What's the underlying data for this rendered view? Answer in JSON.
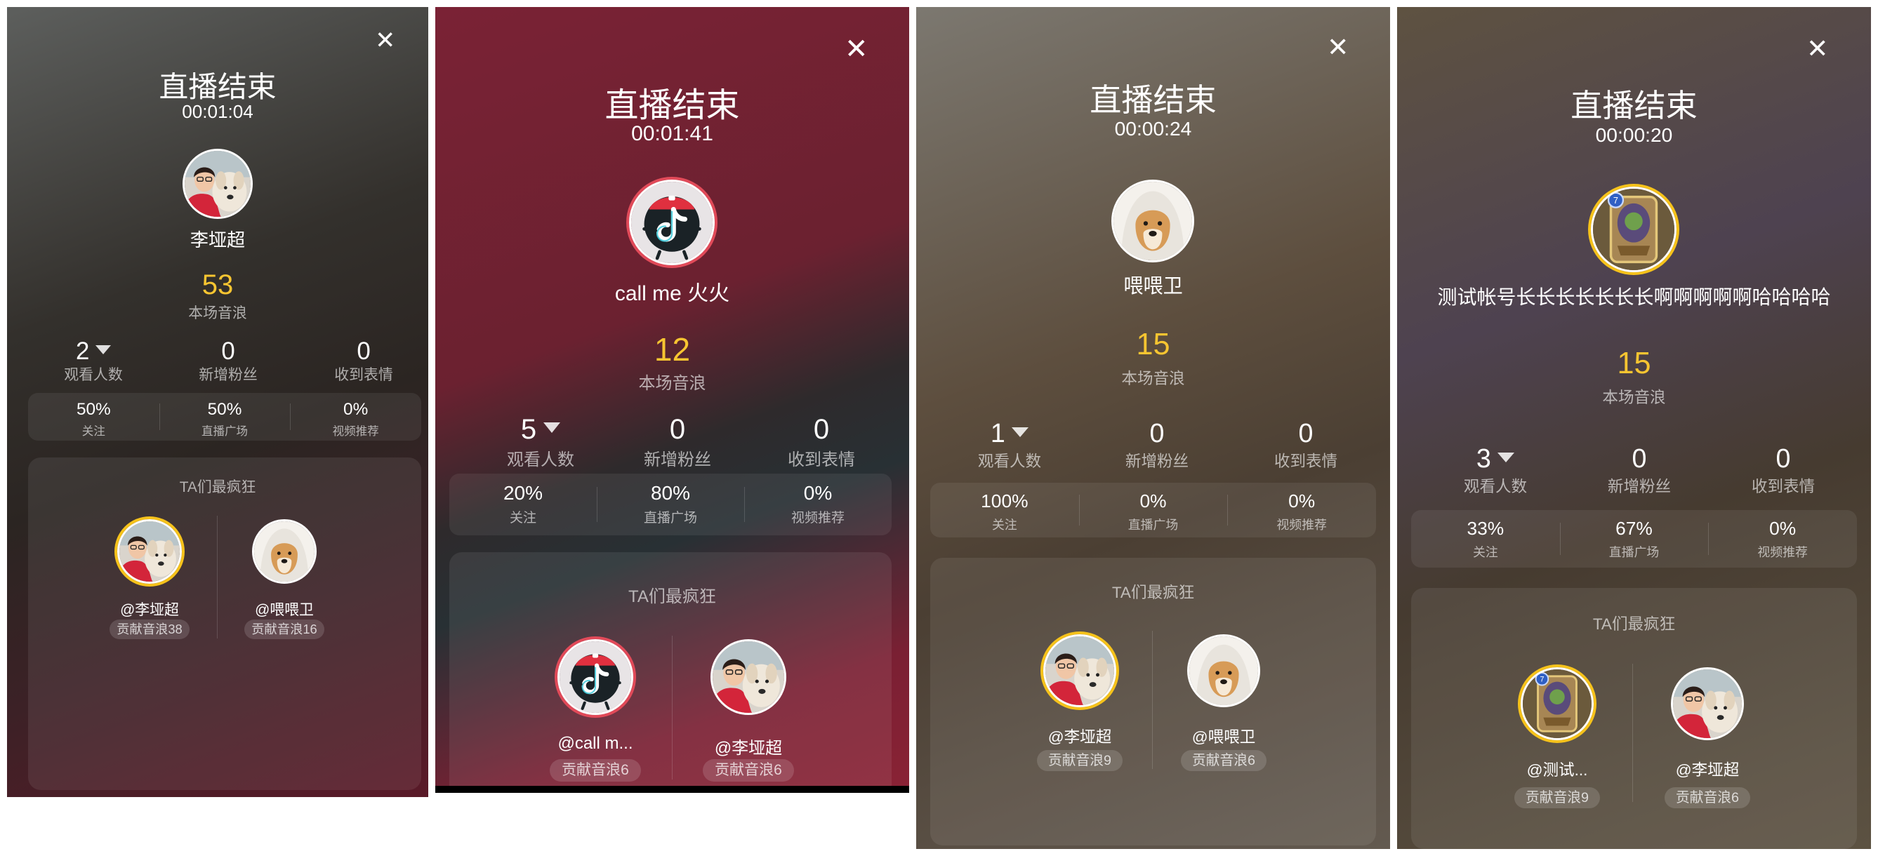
{
  "screens": [
    {
      "close_icon": "close-icon",
      "title": "直播结束",
      "duration": "00:01:04",
      "host": {
        "name": "李垭超",
        "avatar": "person-with-dog"
      },
      "total_yinlang": "53",
      "total_label": "本场音浪",
      "stats": [
        {
          "value": "2",
          "label": "观看人数",
          "has_dropdown": true
        },
        {
          "value": "0",
          "label": "新增粉丝"
        },
        {
          "value": "0",
          "label": "收到表情"
        }
      ],
      "sources": [
        {
          "value": "50%",
          "label": "关注"
        },
        {
          "value": "50%",
          "label": "直播广场"
        },
        {
          "value": "0%",
          "label": "视频推荐"
        }
      ],
      "fans_title": "TA们最疯狂",
      "fans": [
        {
          "name": "@李垭超",
          "contribution": "贡献音浪38",
          "avatar": "person-with-dog"
        },
        {
          "name": "@喂喂卫",
          "contribution": "贡献音浪16",
          "avatar": "shiba-dog"
        }
      ],
      "nav": {
        "style": "light",
        "icons": [
          "back-chevron-icon",
          "square-icon",
          "menu-lines-icon"
        ]
      }
    },
    {
      "close_icon": "close-icon",
      "title": "直播结束",
      "duration": "00:01:41",
      "host": {
        "name": "call me 火火",
        "avatar": "tiktok-logo"
      },
      "total_yinlang": "12",
      "total_label": "本场音浪",
      "stats": [
        {
          "value": "5",
          "label": "观看人数",
          "has_dropdown": true
        },
        {
          "value": "0",
          "label": "新增粉丝"
        },
        {
          "value": "0",
          "label": "收到表情"
        }
      ],
      "sources": [
        {
          "value": "20%",
          "label": "关注"
        },
        {
          "value": "80%",
          "label": "直播广场"
        },
        {
          "value": "0%",
          "label": "视频推荐"
        }
      ],
      "fans_title": "TA们最疯狂",
      "fans": [
        {
          "name": "@call m...",
          "contribution": "贡献音浪6",
          "avatar": "tiktok-logo"
        },
        {
          "name": "@李垭超",
          "contribution": "贡献音浪6",
          "avatar": "person-with-dog"
        }
      ],
      "nav": {
        "style": "dark",
        "icons": [
          "chevron-down-icon",
          "back-triangle-icon",
          "home-circle-icon",
          "recent-square-icon"
        ]
      }
    },
    {
      "close_icon": "close-icon",
      "title": "直播结束",
      "duration": "00:00:24",
      "host": {
        "name": "喂喂卫",
        "avatar": "shiba-dog"
      },
      "total_yinlang": "15",
      "total_label": "本场音浪",
      "stats": [
        {
          "value": "1",
          "label": "观看人数",
          "has_dropdown": true
        },
        {
          "value": "0",
          "label": "新增粉丝"
        },
        {
          "value": "0",
          "label": "收到表情"
        }
      ],
      "sources": [
        {
          "value": "100%",
          "label": "关注"
        },
        {
          "value": "0%",
          "label": "直播广场"
        },
        {
          "value": "0%",
          "label": "视频推荐"
        }
      ],
      "fans_title": "TA们最疯狂",
      "fans": [
        {
          "name": "@李垭超",
          "contribution": "贡献音浪9",
          "avatar": "person-with-dog"
        },
        {
          "name": "@喂喂卫",
          "contribution": "贡献音浪6",
          "avatar": "shiba-dog"
        }
      ],
      "nav": null
    },
    {
      "close_icon": "close-icon",
      "title": "直播结束",
      "duration": "00:00:20",
      "host": {
        "name": "测试帐号长长长长长长长啊啊啊啊啊哈哈哈哈",
        "avatar": "hearthstone-card"
      },
      "total_yinlang": "15",
      "total_label": "本场音浪",
      "stats": [
        {
          "value": "3",
          "label": "观看人数",
          "has_dropdown": true
        },
        {
          "value": "0",
          "label": "新增粉丝"
        },
        {
          "value": "0",
          "label": "收到表情"
        }
      ],
      "sources": [
        {
          "value": "33%",
          "label": "关注"
        },
        {
          "value": "67%",
          "label": "直播广场"
        },
        {
          "value": "0%",
          "label": "视频推荐"
        }
      ],
      "fans_title": "TA们最疯狂",
      "fans": [
        {
          "name": "@测试...",
          "contribution": "贡献音浪9",
          "avatar": "hearthstone-card"
        },
        {
          "name": "@李垭超",
          "contribution": "贡献音浪6",
          "avatar": "person-with-dog"
        }
      ],
      "nav": null
    }
  ]
}
